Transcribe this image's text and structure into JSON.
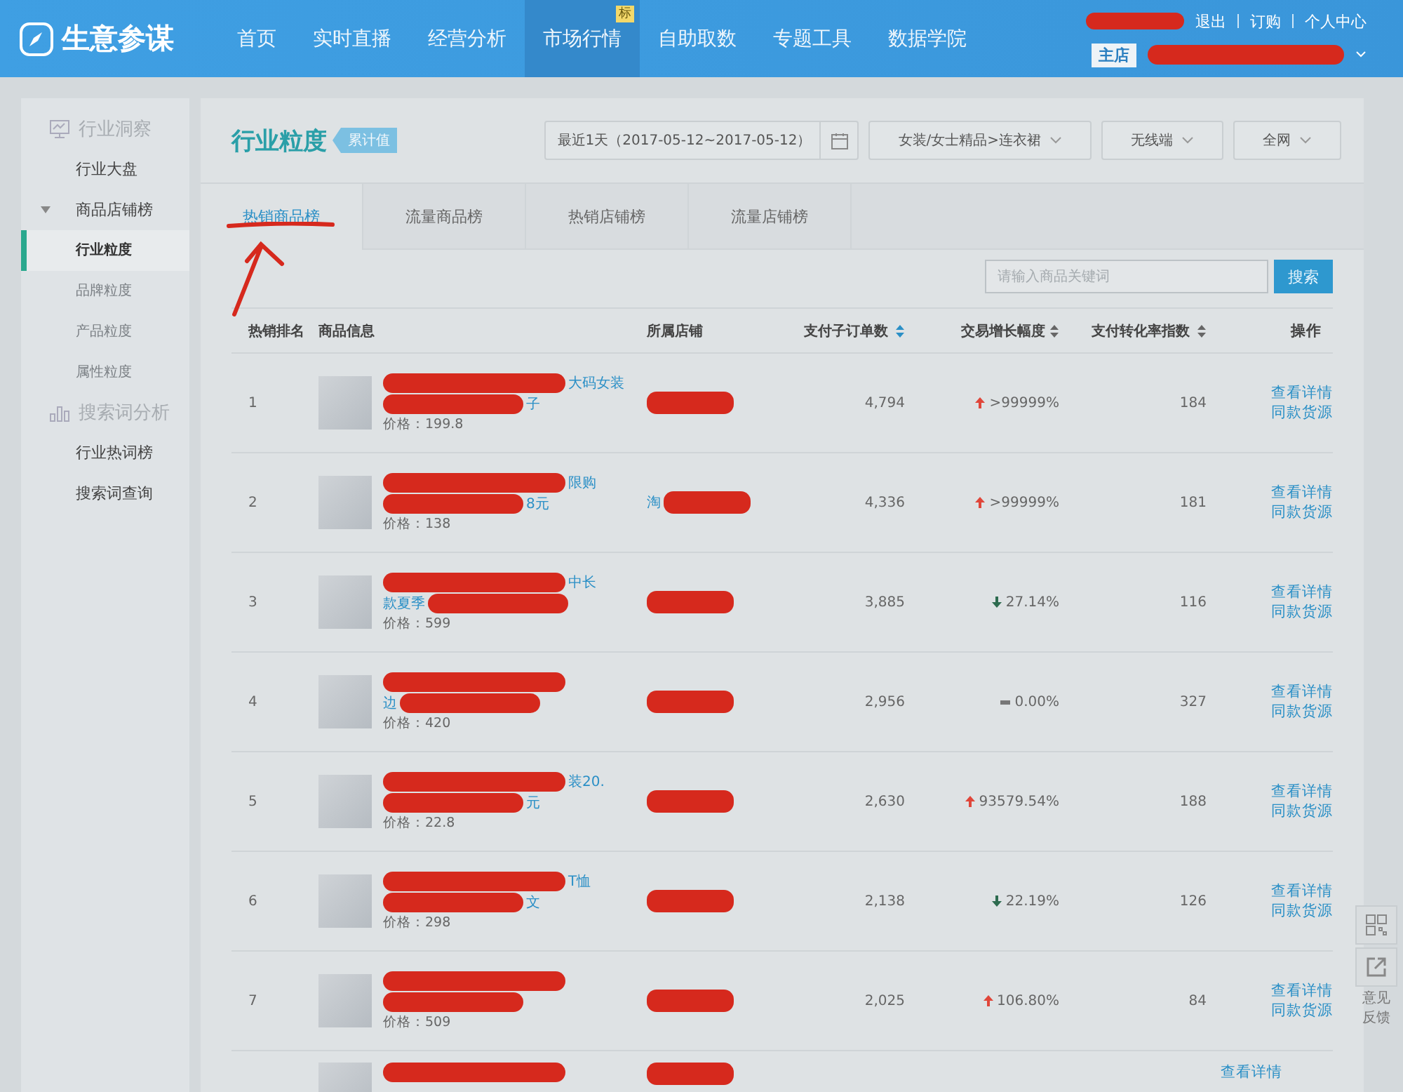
{
  "header": {
    "logo": "生意参谋",
    "nav": [
      {
        "label": "首页",
        "selected": false
      },
      {
        "label": "实时直播",
        "selected": false
      },
      {
        "label": "经营分析",
        "selected": false
      },
      {
        "label": "市场行情",
        "selected": true,
        "badge": "标"
      },
      {
        "label": "自助取数",
        "selected": false
      },
      {
        "label": "专题工具",
        "selected": false
      },
      {
        "label": "数据学院",
        "selected": false
      }
    ],
    "links": [
      "退出",
      "订购",
      "个人中心"
    ],
    "shop_badge": "主店"
  },
  "sidebar": {
    "groups": [
      {
        "title": "行业洞察",
        "items": [
          {
            "label": "行业大盘",
            "selected": false
          },
          {
            "label": "商品店铺榜",
            "selected": false,
            "expanded": true,
            "children": [
              {
                "label": "行业粒度",
                "selected": true
              },
              {
                "label": "品牌粒度",
                "selected": false
              },
              {
                "label": "产品粒度",
                "selected": false
              },
              {
                "label": "属性粒度",
                "selected": false
              }
            ]
          }
        ]
      },
      {
        "title": "搜索词分析",
        "items": [
          {
            "label": "行业热词榜",
            "selected": false
          },
          {
            "label": "搜索词查询",
            "selected": false
          }
        ]
      }
    ]
  },
  "main": {
    "title": "行业粒度",
    "tag": "累计值",
    "filters": [
      {
        "kind": "date",
        "label": "最近1天（2017-05-12~2017-05-12）"
      },
      {
        "kind": "dropdown",
        "label": "女装/女士精品>连衣裙"
      },
      {
        "kind": "dropdown",
        "label": "无线端"
      },
      {
        "kind": "dropdown",
        "label": "全网"
      }
    ],
    "tabs": [
      {
        "label": "热销商品榜",
        "selected": true
      },
      {
        "label": "流量商品榜",
        "selected": false
      },
      {
        "label": "热销店铺榜",
        "selected": false
      },
      {
        "label": "流量店铺榜",
        "selected": false
      }
    ],
    "search": {
      "placeholder": "请输入商品关键词",
      "button": "搜索"
    },
    "table": {
      "columns": [
        {
          "label": "热销排名"
        },
        {
          "label": "商品信息"
        },
        {
          "label": "所属店铺"
        },
        {
          "label": "支付子订单数",
          "sorted": true
        },
        {
          "label": "交易增长幅度",
          "sorted": false
        },
        {
          "label": "支付转化率指数",
          "sorted": false
        },
        {
          "label": "操作"
        }
      ],
      "rows": [
        {
          "rank": "1",
          "title": [
            [
              {
                "kind": "redaction"
              },
              {
                "kind": "text",
                "text": "大码女装"
              }
            ],
            [
              {
                "kind": "redaction"
              },
              {
                "kind": "text",
                "text": "子"
              }
            ]
          ],
          "price": "价格：199.8",
          "shop": [
            {
              "kind": "redaction"
            }
          ],
          "orders": "4,794",
          "growth": {
            "kind": "up",
            "text": ">99999%"
          },
          "conversion": "184",
          "actions": [
            "查看详情",
            "同款货源"
          ]
        },
        {
          "rank": "2",
          "title": [
            [
              {
                "kind": "redaction"
              },
              {
                "kind": "text",
                "text": "限购"
              }
            ],
            [
              {
                "kind": "redaction"
              },
              {
                "kind": "text",
                "text": "8元"
              }
            ]
          ],
          "price": "价格：138",
          "shop": [
            {
              "kind": "text",
              "text": "淘"
            },
            {
              "kind": "redaction"
            }
          ],
          "orders": "4,336",
          "growth": {
            "kind": "up",
            "text": ">99999%"
          },
          "conversion": "181",
          "actions": [
            "查看详情",
            "同款货源"
          ]
        },
        {
          "rank": "3",
          "title": [
            [
              {
                "kind": "redaction"
              },
              {
                "kind": "text",
                "text": "中长"
              }
            ],
            [
              {
                "kind": "text",
                "text": "款夏季"
              },
              {
                "kind": "redaction"
              }
            ]
          ],
          "price": "价格：599",
          "shop": [
            {
              "kind": "redaction"
            }
          ],
          "orders": "3,885",
          "growth": {
            "kind": "down",
            "text": "27.14%"
          },
          "conversion": "116",
          "actions": [
            "查看详情",
            "同款货源"
          ]
        },
        {
          "rank": "4",
          "title": [
            [
              {
                "kind": "redaction"
              }
            ],
            [
              {
                "kind": "text",
                "text": "边"
              },
              {
                "kind": "redaction"
              }
            ]
          ],
          "price": "价格：420",
          "shop": [
            {
              "kind": "redaction"
            }
          ],
          "orders": "2,956",
          "growth": {
            "kind": "flat",
            "text": "0.00%"
          },
          "conversion": "327",
          "actions": [
            "查看详情",
            "同款货源"
          ]
        },
        {
          "rank": "5",
          "title": [
            [
              {
                "kind": "redaction"
              },
              {
                "kind": "text",
                "text": "装20."
              }
            ],
            [
              {
                "kind": "redaction"
              },
              {
                "kind": "text",
                "text": "元"
              }
            ]
          ],
          "price": "价格：22.8",
          "shop": [
            {
              "kind": "redaction"
            }
          ],
          "orders": "2,630",
          "growth": {
            "kind": "up",
            "text": "93579.54%"
          },
          "conversion": "188",
          "actions": [
            "查看详情",
            "同款货源"
          ]
        },
        {
          "rank": "6",
          "title": [
            [
              {
                "kind": "redaction"
              },
              {
                "kind": "text",
                "text": "T恤"
              }
            ],
            [
              {
                "kind": "redaction"
              },
              {
                "kind": "text",
                "text": "文"
              }
            ]
          ],
          "price": "价格：298",
          "shop": [
            {
              "kind": "redaction"
            }
          ],
          "orders": "2,138",
          "growth": {
            "kind": "down",
            "text": "22.19%"
          },
          "conversion": "126",
          "actions": [
            "查看详情",
            "同款货源"
          ]
        },
        {
          "rank": "7",
          "title": [
            [
              {
                "kind": "redaction"
              }
            ],
            [
              {
                "kind": "redaction"
              }
            ]
          ],
          "price": "价格：509",
          "shop": [
            {
              "kind": "redaction"
            }
          ],
          "orders": "2,025",
          "growth": {
            "kind": "up",
            "text": "106.80%"
          },
          "conversion": "84",
          "actions": [
            "查看详情",
            "同款货源"
          ]
        },
        {
          "title": [
            [
              {
                "kind": "redaction"
              }
            ]
          ],
          "shop": [
            {
              "kind": "redaction"
            }
          ],
          "actions": [
            "查看详情"
          ]
        }
      ]
    }
  },
  "feedback": "意见反馈"
}
